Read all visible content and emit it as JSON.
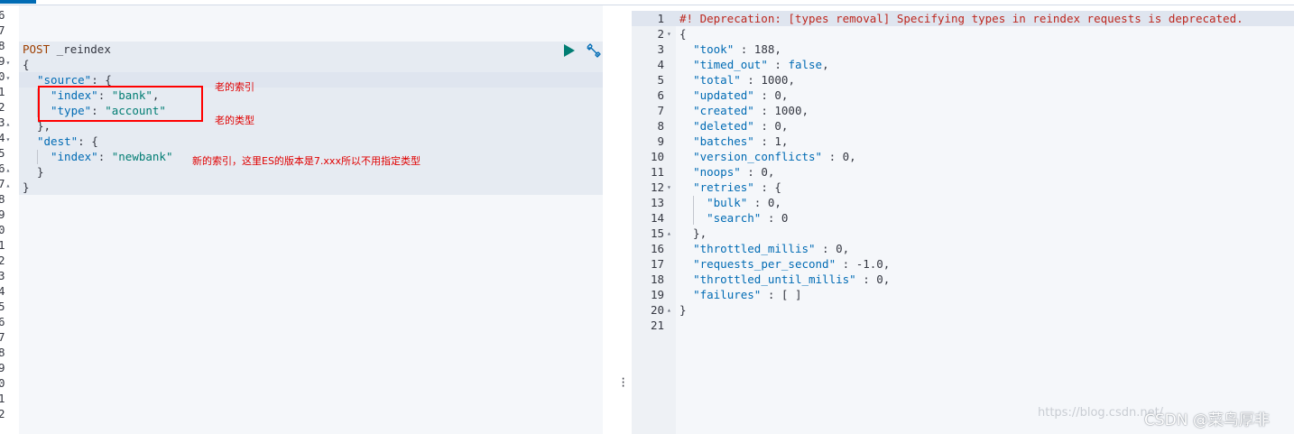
{
  "left_editor": {
    "gutter_numbers": [
      "6",
      "7",
      "8",
      "9",
      "0",
      "1",
      "2",
      "3",
      "4",
      "5",
      "6",
      "7",
      "8",
      "9",
      "0",
      "1",
      "2",
      "3",
      "4",
      "5",
      "6",
      "7",
      "8",
      "9",
      "0",
      "1",
      "2"
    ],
    "method": "POST",
    "url": "_reindex",
    "lines": {
      "l1": "{",
      "l2_key": "\"source\"",
      "l2_rest": ": {",
      "l3_key": "\"index\"",
      "l3_val": "\"bank\"",
      "l4_key": "\"type\"",
      "l4_val": "\"account\"",
      "l5": "},",
      "l6_key": "\"dest\"",
      "l6_rest": ": {",
      "l7_key": "\"index\"",
      "l7_val": "\"newbank\"",
      "l8": "}",
      "l9": "}"
    }
  },
  "annotations": {
    "old_index": "老的索引",
    "old_type": "老的类型",
    "new_index_note": "新的索引，这里ES的版本是7.xxx所以不用指定类型"
  },
  "right_editor": {
    "warning": "#! Deprecation: [types removal] Specifying types in reindex requests is deprecated.",
    "took": "188",
    "timed_out": "false",
    "total": "1000",
    "updated": "0",
    "created": "1000",
    "deleted": "0",
    "batches": "1",
    "version_conflicts": "0",
    "noops": "0",
    "bulk": "0",
    "search": "0",
    "throttled_millis": "0",
    "requests_per_second": "-1.0",
    "throttled_until_millis": "0",
    "failures": "[ ]"
  },
  "watermark": {
    "url": "https://blog.csdn.net/",
    "brand": "CSDN @菜鸟厚非"
  },
  "colors": {
    "accent": "#006bb4",
    "run_green": "#017d73",
    "annotation_red": "#ff0000"
  },
  "icons": [
    "play-icon",
    "wrench-icon",
    "drag-handle-icon"
  ]
}
